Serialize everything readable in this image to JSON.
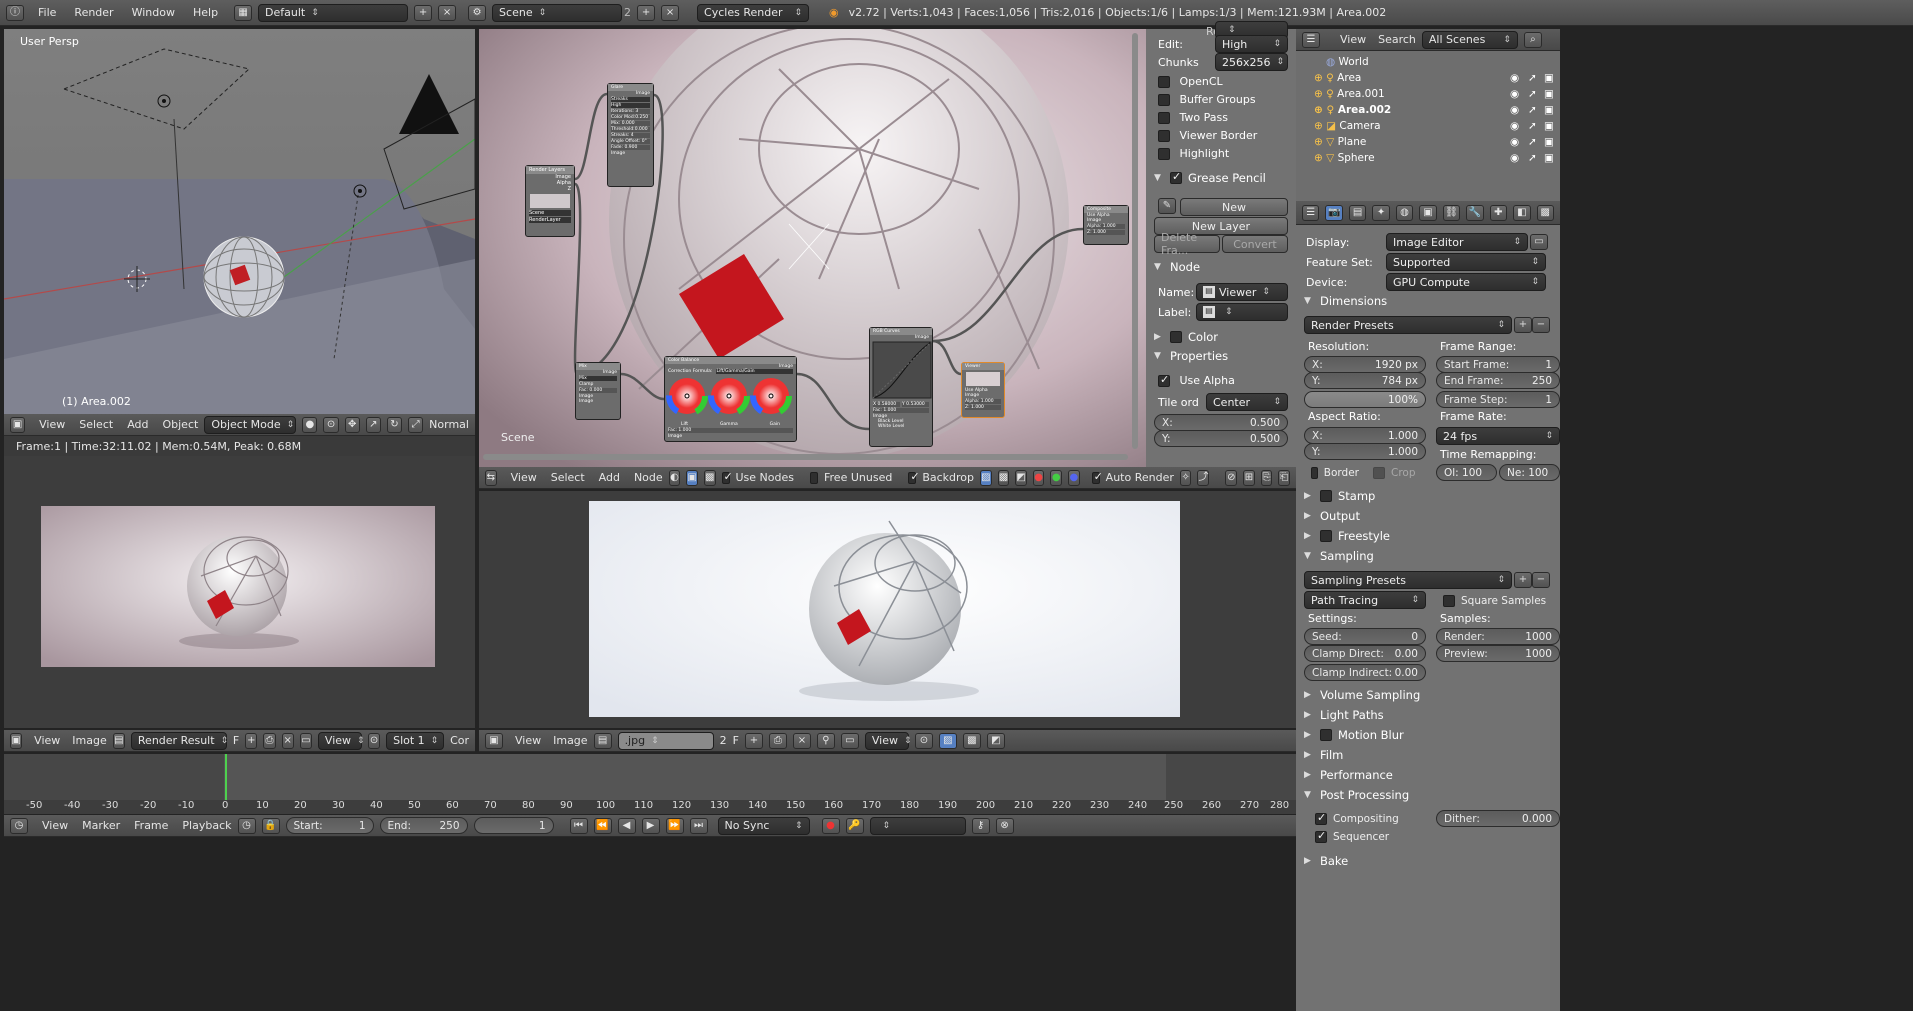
{
  "info": {
    "menus": [
      "File",
      "Render",
      "Window",
      "Help"
    ],
    "layout": "Default",
    "scene": "Scene",
    "scene_users": "2",
    "engine": "Cycles Render",
    "stats": "v2.72 | Verts:1,043 | Faces:1,056 | Tris:2,016 | Objects:1/6 | Lamps:1/3 | Mem:121.93M | Area.002"
  },
  "viewport3d": {
    "label": "User Persp",
    "object_label": "(1) Area.002",
    "menus": [
      "View",
      "Select",
      "Add",
      "Object"
    ],
    "mode": "Object Mode",
    "orientation": "Normal"
  },
  "nodeeditor": {
    "scene_label": "Scene",
    "menus": [
      "View",
      "Select",
      "Add",
      "Node"
    ],
    "use_nodes": "Use Nodes",
    "free_unused": "Free Unused",
    "backdrop": "Backdrop",
    "auto_render": "Auto Render"
  },
  "nodes": {
    "render_layers": {
      "title": "Render Layers",
      "outputs": [
        "Image",
        "Alpha",
        "Z"
      ],
      "scene": "Scene",
      "layer": "RenderLayer"
    },
    "glare": {
      "title": "Glare",
      "output": "Image",
      "fields": [
        "Streaks",
        "High",
        "Iterations: 3",
        "Color Mod:0.250",
        "Mix: 0.000",
        "Threshold:0.000",
        "Streaks: 4",
        "Angle Offset: 0°",
        "Fade: 0.900"
      ],
      "input": "Image"
    },
    "mix": {
      "title": "Mix",
      "output": "Image",
      "mode": "Mix",
      "clamp": "Clamp",
      "fac": "Fac: 0.000",
      "inputs": [
        "Image",
        "Image"
      ]
    },
    "color_balance": {
      "title": "Color Balance",
      "output": "Image",
      "formula_label": "Correction Formula:",
      "formula": "Lift/Gamma/Gain",
      "wheels": [
        "Lift",
        "Gamma",
        "Gain"
      ],
      "fac": "Fac: 1.000",
      "input": "Image"
    },
    "rgb_curves": {
      "title": "RGB Curves",
      "output": "Image",
      "fields": [
        "X 0.58000",
        "Y 0.53000"
      ],
      "fac": "Fac: 1.000",
      "inputs": [
        "Image",
        "Black Level",
        "White Level"
      ]
    },
    "viewer": {
      "title": "Viewer",
      "use_alpha": "Use Alpha",
      "inputs": [
        "Image",
        "Alpha: 1.000",
        "Z: 1.000"
      ]
    },
    "composite": {
      "title": "Composite",
      "use_alpha": "Use Alpha",
      "inputs": [
        "Image",
        "Alpha: 1.000",
        "Z: 1.000"
      ]
    }
  },
  "nodeprops": {
    "cut_label": "Render:",
    "edit_label": "Edit:",
    "edit": "High",
    "chunks_label": "Chunks",
    "chunks": "256x256",
    "checks": [
      {
        "label": "OpenCL",
        "on": false
      },
      {
        "label": "Buffer Groups",
        "on": false
      },
      {
        "label": "Two Pass",
        "on": false
      },
      {
        "label": "Viewer Border",
        "on": false
      },
      {
        "label": "Highlight",
        "on": false
      }
    ],
    "grease_pencil": "Grease Pencil",
    "new_btn": "New",
    "new_layer": "New Layer",
    "delete_frame": "Delete Fra...",
    "convert": "Convert",
    "node_section": "Node",
    "name_label": "Name:",
    "name": "Viewer",
    "label_label": "Label:",
    "label_value": "",
    "color_section": "Color",
    "properties_section": "Properties",
    "use_alpha": "Use Alpha",
    "tile_label": "Tile ord",
    "tile": "Center",
    "x": {
      "k": "X:",
      "v": "0.500"
    },
    "y": {
      "k": "Y:",
      "v": "0.500"
    }
  },
  "render_result": {
    "status": "Frame:1 | Time:32:11.02 | Mem:0.54M, Peak: 0.68M",
    "menus": [
      "View",
      "Image"
    ],
    "image": "Render Result",
    "fake": "F",
    "view": "View",
    "slot": "Slot 1",
    "extra": "Cor"
  },
  "image_editor": {
    "menus": [
      "View",
      "Image"
    ],
    "image": ".jpg",
    "users": "2",
    "fake": "F",
    "view": "View"
  },
  "outliner": {
    "menus": [
      "View",
      "Search"
    ],
    "filter": "All Scenes",
    "items": [
      "World",
      "Area",
      "Area.001",
      "Area.002",
      "Camera",
      "Plane",
      "Sphere"
    ]
  },
  "properties": {
    "display_label": "Display:",
    "display": "Image Editor",
    "feature_label": "Feature Set:",
    "feature": "Supported",
    "device_label": "Device:",
    "device": "GPU Compute",
    "dimensions": "Dimensions",
    "render_presets": "Render Presets",
    "resolution_label": "Resolution:",
    "res_x": {
      "k": "X:",
      "v": "1920 px"
    },
    "res_y": {
      "k": "Y:",
      "v": "784 px"
    },
    "res_pct": "100%",
    "frame_range_label": "Frame Range:",
    "start_frame": {
      "k": "Start Frame:",
      "v": "1"
    },
    "end_frame": {
      "k": "End Frame:",
      "v": "250"
    },
    "frame_step": {
      "k": "Frame Step:",
      "v": "1"
    },
    "aspect_label": "Aspect Ratio:",
    "asp_x": {
      "k": "X:",
      "v": "1.000"
    },
    "asp_y": {
      "k": "Y:",
      "v": "1.000"
    },
    "frame_rate_label": "Frame Rate:",
    "fps": "24 fps",
    "time_remap_label": "Time Remapping:",
    "old": "Ol: 100",
    "new": "Ne: 100",
    "border": "Border",
    "crop": "Crop",
    "stamp": "Stamp",
    "output": "Output",
    "freestyle": "Freestyle",
    "sampling": "Sampling",
    "sampling_presets": "Sampling Presets",
    "integrator": "Path Tracing",
    "square_samples": "Square Samples",
    "settings_label": "Settings:",
    "seed": {
      "k": "Seed:",
      "v": "0"
    },
    "clamp_direct": {
      "k": "Clamp Direct:",
      "v": "0.00"
    },
    "clamp_indirect": {
      "k": "Clamp Indirect:",
      "v": "0.00"
    },
    "samples_label": "Samples:",
    "render_samples": {
      "k": "Render:",
      "v": "1000"
    },
    "preview_samples": {
      "k": "Preview:",
      "v": "1000"
    },
    "volume_sampling": "Volume Sampling",
    "light_paths": "Light Paths",
    "motion_blur": "Motion Blur",
    "film": "Film",
    "performance": "Performance",
    "post_processing": "Post Processing",
    "compositing": "Compositing",
    "sequencer": "Sequencer",
    "dither": {
      "k": "Dither:",
      "v": "0.000"
    },
    "bake": "Bake"
  },
  "timeline": {
    "ticks": [
      "-50",
      "-40",
      "-30",
      "-20",
      "-10",
      "0",
      "10",
      "20",
      "30",
      "40",
      "50",
      "60",
      "70",
      "80",
      "90",
      "100",
      "110",
      "120",
      "130",
      "140",
      "150",
      "160",
      "170",
      "180",
      "190",
      "200",
      "210",
      "220",
      "230",
      "240",
      "250",
      "260",
      "270",
      "280"
    ],
    "menus": [
      "View",
      "Marker",
      "Frame",
      "Playback"
    ],
    "start": {
      "k": "Start:",
      "v": "1"
    },
    "end": {
      "k": "End:",
      "v": "250"
    },
    "current": "1",
    "sync": "No Sync"
  }
}
